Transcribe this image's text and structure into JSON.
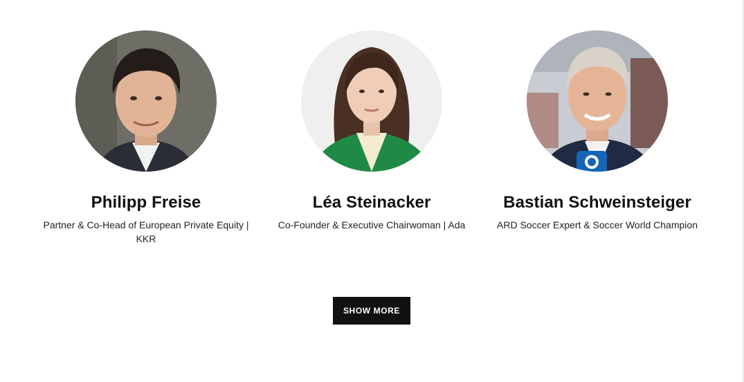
{
  "speakers": [
    {
      "name": "Philipp Freise",
      "role": "Partner & Co-Head of European Private Equity | KKR"
    },
    {
      "name": "Léa Steinacker",
      "role": "Co-Founder & Executive Chairwoman | Ada"
    },
    {
      "name": "Bastian Schweinsteiger",
      "role": "ARD Soccer Expert & Soccer World Champion"
    }
  ],
  "actions": {
    "show_more_label": "SHOW MORE"
  },
  "colors": {
    "button_bg": "#111111",
    "button_text": "#ffffff",
    "text": "#111111",
    "background": "#ffffff"
  }
}
